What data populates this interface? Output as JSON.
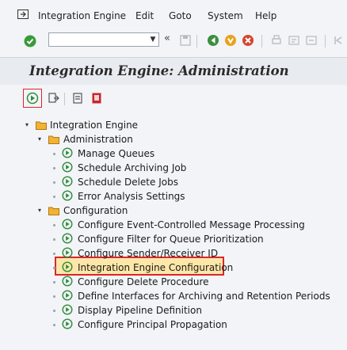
{
  "menubar": {
    "items": [
      "Integration Engine",
      "Edit",
      "Goto",
      "System",
      "Help"
    ]
  },
  "toolbar": {
    "command_field": {
      "value": "",
      "placeholder": ""
    },
    "back_glyph": "«"
  },
  "title": "Integration Engine: Administration",
  "tree": {
    "root": "Integration Engine",
    "groups": [
      {
        "label": "Administration",
        "items": [
          "Manage Queues",
          "Schedule Archiving Job",
          "Schedule Delete Jobs",
          "Error Analysis Settings"
        ]
      },
      {
        "label": "Configuration",
        "items": [
          "Configure Event-Controlled Message Processing",
          "Configure Filter for Queue Prioritization",
          "Configure Sender/Receiver ID",
          "Integration Engine Configuration",
          "Configure Delete Procedure",
          "Define Interfaces for Archiving and Retention Periods",
          "Display Pipeline Definition",
          "Configure Principal Propagation"
        ]
      }
    ]
  },
  "colors": {
    "highlight_border": "#d9262d",
    "highlight_fill": "#fde7a8",
    "folder": "#f2b233",
    "exec_icon": "#2e8b3a"
  }
}
